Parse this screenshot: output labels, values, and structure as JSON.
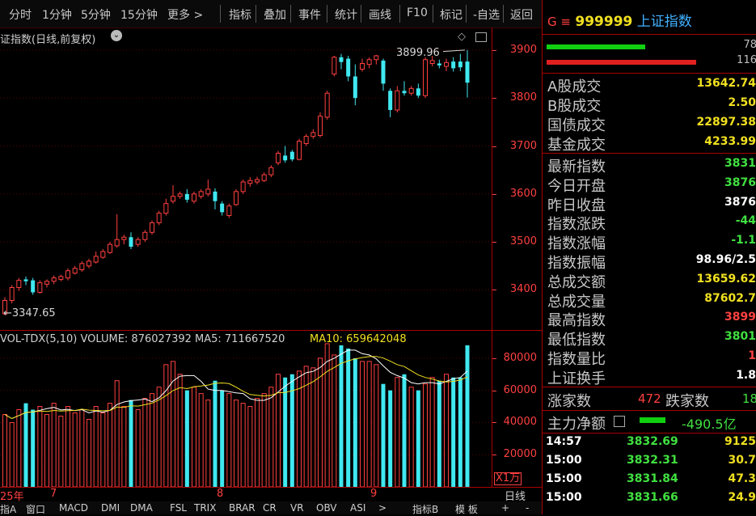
{
  "toolbar": {
    "items": [
      "分时",
      "1分钟",
      "5分钟",
      "15分钟",
      "更多 >",
      "指标",
      "叠加",
      "事件",
      "统计",
      "画线",
      "F10",
      "标记",
      "-自选",
      "返回"
    ]
  },
  "chart_header": {
    "title": "证指数(日线,前复权)",
    "volume_label": "VOL-TDX(5,10) VOLUME: 876027392 MA5: 711667520",
    "ma10_label": "MA10: 659642048",
    "high_annotation": "3899.96",
    "low_annotation": "←3347.65",
    "vol_unit": "X1万"
  },
  "colors": {
    "up": "#ff4040",
    "down": "#40e8f0",
    "ma5": "#ffffff",
    "ma10": "#f0e020",
    "axis": "#ff4040",
    "label_yellow": "#f0e020"
  },
  "dates": [
    "25年",
    "7",
    "8",
    "9"
  ],
  "date_right": "日线",
  "bottom_tabs": [
    "指A",
    "窗口",
    "MACD",
    "DMI",
    "DMA",
    "FSL",
    "TRIX",
    "BRAR",
    "CR",
    "VR",
    "OBV",
    "ASI",
    ">",
    "指标B",
    "模 板",
    "+",
    "-"
  ],
  "chart_data": {
    "type": "candlestick",
    "price_ticks": [
      3900,
      3800,
      3700,
      3600,
      3500,
      3400
    ],
    "price_range": [
      3330,
      3920
    ],
    "volume_ticks": [
      80000,
      60000,
      40000,
      20000
    ],
    "volume_range": [
      0,
      92000
    ],
    "candles": [
      {
        "o": 3350,
        "c": 3378,
        "h": 3385,
        "l": 3347.65
      },
      {
        "o": 3378,
        "c": 3405,
        "h": 3410,
        "l": 3372
      },
      {
        "o": 3405,
        "c": 3420,
        "h": 3425,
        "l": 3398
      },
      {
        "o": 3422,
        "c": 3418,
        "h": 3428,
        "l": 3410
      },
      {
        "o": 3420,
        "c": 3395,
        "h": 3425,
        "l": 3390
      },
      {
        "o": 3395,
        "c": 3415,
        "h": 3420,
        "l": 3392
      },
      {
        "o": 3412,
        "c": 3418,
        "h": 3422,
        "l": 3405
      },
      {
        "o": 3418,
        "c": 3425,
        "h": 3430,
        "l": 3412
      },
      {
        "o": 3422,
        "c": 3428,
        "h": 3432,
        "l": 3418
      },
      {
        "o": 3425,
        "c": 3440,
        "h": 3445,
        "l": 3420
      },
      {
        "o": 3435,
        "c": 3445,
        "h": 3450,
        "l": 3432
      },
      {
        "o": 3442,
        "c": 3455,
        "h": 3460,
        "l": 3438
      },
      {
        "o": 3450,
        "c": 3460,
        "h": 3465,
        "l": 3445
      },
      {
        "o": 3458,
        "c": 3470,
        "h": 3480,
        "l": 3455
      },
      {
        "o": 3468,
        "c": 3480,
        "h": 3485,
        "l": 3465
      },
      {
        "o": 3478,
        "c": 3495,
        "h": 3500,
        "l": 3475
      },
      {
        "o": 3492,
        "c": 3505,
        "h": 3558,
        "l": 3488
      },
      {
        "o": 3505,
        "c": 3510,
        "h": 3515,
        "l": 3495
      },
      {
        "o": 3510,
        "c": 3490,
        "h": 3520,
        "l": 3485
      },
      {
        "o": 3495,
        "c": 3505,
        "h": 3510,
        "l": 3490
      },
      {
        "o": 3505,
        "c": 3520,
        "h": 3525,
        "l": 3500
      },
      {
        "o": 3520,
        "c": 3540,
        "h": 3545,
        "l": 3515
      },
      {
        "o": 3540,
        "c": 3560,
        "h": 3565,
        "l": 3535
      },
      {
        "o": 3560,
        "c": 3580,
        "h": 3590,
        "l": 3555
      },
      {
        "o": 3585,
        "c": 3595,
        "h": 3618,
        "l": 3580
      },
      {
        "o": 3595,
        "c": 3600,
        "h": 3605,
        "l": 3590
      },
      {
        "o": 3600,
        "c": 3588,
        "h": 3610,
        "l": 3582
      },
      {
        "o": 3585,
        "c": 3600,
        "h": 3605,
        "l": 3580
      },
      {
        "o": 3595,
        "c": 3605,
        "h": 3610,
        "l": 3590
      },
      {
        "o": 3600,
        "c": 3610,
        "h": 3630,
        "l": 3595
      },
      {
        "o": 3605,
        "c": 3585,
        "h": 3612,
        "l": 3568
      },
      {
        "o": 3580,
        "c": 3562,
        "h": 3585,
        "l": 3555
      },
      {
        "o": 3555,
        "c": 3575,
        "h": 3580,
        "l": 3550
      },
      {
        "o": 3578,
        "c": 3605,
        "h": 3610,
        "l": 3575
      },
      {
        "o": 3605,
        "c": 3625,
        "h": 3630,
        "l": 3600
      },
      {
        "o": 3622,
        "c": 3628,
        "h": 3635,
        "l": 3615
      },
      {
        "o": 3625,
        "c": 3630,
        "h": 3636,
        "l": 3620
      },
      {
        "o": 3628,
        "c": 3640,
        "h": 3645,
        "l": 3625
      },
      {
        "o": 3640,
        "c": 3655,
        "h": 3660,
        "l": 3635
      },
      {
        "o": 3665,
        "c": 3685,
        "h": 3690,
        "l": 3660
      },
      {
        "o": 3680,
        "c": 3670,
        "h": 3700,
        "l": 3665
      },
      {
        "o": 3688,
        "c": 3672,
        "h": 3692,
        "l": 3668
      },
      {
        "o": 3672,
        "c": 3710,
        "h": 3715,
        "l": 3670
      },
      {
        "o": 3705,
        "c": 3720,
        "h": 3725,
        "l": 3700
      },
      {
        "o": 3720,
        "c": 3728,
        "h": 3735,
        "l": 3715
      },
      {
        "o": 3722,
        "c": 3762,
        "h": 3770,
        "l": 3718
      },
      {
        "o": 3760,
        "c": 3810,
        "h": 3815,
        "l": 3755
      },
      {
        "o": 3850,
        "c": 3885,
        "h": 3888,
        "l": 3845
      },
      {
        "o": 3885,
        "c": 3875,
        "h": 3892,
        "l": 3860
      },
      {
        "o": 3882,
        "c": 3845,
        "h": 3888,
        "l": 3835
      },
      {
        "o": 3845,
        "c": 3800,
        "h": 3870,
        "l": 3785
      },
      {
        "o": 3860,
        "c": 3872,
        "h": 3882,
        "l": 3855
      },
      {
        "o": 3870,
        "c": 3880,
        "h": 3885,
        "l": 3862
      },
      {
        "o": 3880,
        "c": 3888,
        "h": 3890,
        "l": 3870
      },
      {
        "o": 3878,
        "c": 3830,
        "h": 3882,
        "l": 3815
      },
      {
        "o": 3815,
        "c": 3775,
        "h": 3820,
        "l": 3760
      },
      {
        "o": 3775,
        "c": 3815,
        "h": 3825,
        "l": 3770
      },
      {
        "o": 3815,
        "c": 3810,
        "h": 3835,
        "l": 3805
      },
      {
        "o": 3810,
        "c": 3820,
        "h": 3825,
        "l": 3805
      },
      {
        "o": 3820,
        "c": 3805,
        "h": 3830,
        "l": 3800
      },
      {
        "o": 3805,
        "c": 3880,
        "h": 3885,
        "l": 3800
      },
      {
        "o": 3872,
        "c": 3878,
        "h": 3888,
        "l": 3866
      },
      {
        "o": 3872,
        "c": 3868,
        "h": 3880,
        "l": 3862
      },
      {
        "o": 3866,
        "c": 3874,
        "h": 3882,
        "l": 3856
      },
      {
        "o": 3876,
        "c": 3862,
        "h": 3885,
        "l": 3855
      },
      {
        "o": 3876,
        "c": 3864,
        "h": 3892,
        "l": 3856
      },
      {
        "o": 3876,
        "c": 3832,
        "h": 3899.96,
        "l": 3801
      }
    ],
    "volumes": [
      45000,
      40000,
      48000,
      52000,
      48000,
      50000,
      45000,
      52000,
      44000,
      50000,
      46000,
      48000,
      42000,
      50000,
      46000,
      52000,
      66000,
      50000,
      54000,
      48000,
      55000,
      58000,
      62000,
      76000,
      78000,
      70000,
      60000,
      62000,
      58000,
      54000,
      66000,
      60000,
      58000,
      54000,
      52000,
      50000,
      55000,
      58000,
      62000,
      70000,
      68000,
      70000,
      72000,
      75000,
      74000,
      80000,
      89000,
      82000,
      88000,
      86000,
      80000,
      78000,
      78000,
      76000,
      64000,
      60000,
      68000,
      70000,
      62000,
      60000,
      64000,
      68000,
      66000,
      70000,
      68000,
      68000,
      88000
    ]
  },
  "quote": {
    "code_label": "G ≡",
    "code": "999999",
    "name": "上证指数",
    "bar1_value": "78",
    "bar2_value": "116",
    "rows1": [
      {
        "label": "A股成交",
        "value": "13642.74"
      },
      {
        "label": "B股成交",
        "value": "2.50"
      },
      {
        "label": "国债成交",
        "value": "22897.38"
      },
      {
        "label": "基金成交",
        "value": "4233.99"
      }
    ],
    "rows2": [
      {
        "label": "最新指数",
        "value": "3831",
        "color": "#40e040"
      },
      {
        "label": "今日开盘",
        "value": "3876",
        "color": "#40e040"
      },
      {
        "label": "昨日收盘",
        "value": "3876",
        "color": "#ffffff"
      },
      {
        "label": "指数涨跌",
        "value": "-44",
        "color": "#40e040"
      },
      {
        "label": "指数涨幅",
        "value": "-1.1",
        "color": "#40e040"
      },
      {
        "label": "指数振幅",
        "value": "98.96/2.5",
        "color": "#ffffff"
      },
      {
        "label": "总成交额",
        "value": "13659.62",
        "color": "#f0e020"
      },
      {
        "label": "总成交量",
        "value": "87602.7",
        "color": "#f0e020"
      },
      {
        "label": "最高指数",
        "value": "3899",
        "color": "#ff4040"
      },
      {
        "label": "最低指数",
        "value": "3801",
        "color": "#40e040"
      },
      {
        "label": "指数量比",
        "value": "1",
        "color": "#ff4040"
      },
      {
        "label": "上证换手",
        "value": "1.8",
        "color": "#ffffff"
      }
    ],
    "up_label": "涨家数",
    "up_count": "472",
    "down_label": "跌家数",
    "down_count": "18",
    "net_label": "主力净额",
    "net_value": "-490.5亿",
    "trades": [
      {
        "time": "14:57",
        "price": "3832.69",
        "vol": "9125"
      },
      {
        "time": "15:00",
        "price": "3832.31",
        "vol": "30.7"
      },
      {
        "time": "15:00",
        "price": "3831.84",
        "vol": "47.3"
      },
      {
        "time": "15:00",
        "price": "3831.66",
        "vol": "24.9"
      }
    ]
  }
}
